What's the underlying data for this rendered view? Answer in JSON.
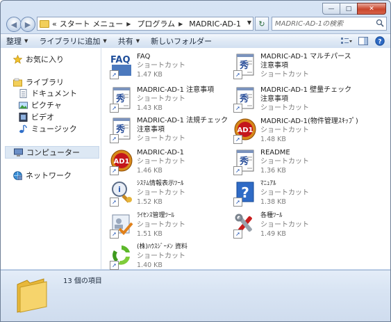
{
  "address": {
    "overflow": "«",
    "crumbs": [
      "スタート メニュー",
      "プログラム",
      "MADRIC-AD-1"
    ]
  },
  "search": {
    "placeholder": "MADRIC-AD-1の検索"
  },
  "toolbar": {
    "organize": "整理",
    "add_to_library": "ライブラリに追加",
    "share": "共有",
    "new_folder": "新しいフォルダー"
  },
  "nav": {
    "favorites": "お気に入り",
    "libraries": "ライブラリ",
    "documents": "ドキュメント",
    "pictures": "ピクチャ",
    "videos": "ビデオ",
    "music": "ミュージック",
    "computer": "コンピューター",
    "network": "ネットワーク"
  },
  "files": [
    {
      "name": "FAQ",
      "type": "ショートカット",
      "size": "1.47 KB",
      "icon": "faq-icon"
    },
    {
      "name": "MADRIC-AD-1 マルチパース 注意事項",
      "type": "ショートカット",
      "size": "",
      "icon": "document-icon"
    },
    {
      "name": "MADRIC-AD-1 注意事項",
      "type": "ショートカット",
      "size": "1.43 KB",
      "icon": "document-icon"
    },
    {
      "name": "MADRIC-AD-1 壁量チェック 注意事項",
      "type": "ショートカット",
      "size": "",
      "icon": "document-icon"
    },
    {
      "name": "MADRIC-AD-1 法規チェック 注意事項",
      "type": "ショートカット",
      "size": "",
      "icon": "document-icon"
    },
    {
      "name": "MADRIC-AD-1(物件管理ｽｷｯﾌﾟ)",
      "type": "ショートカット",
      "size": "1.48 KB",
      "icon": "ad1-app-icon"
    },
    {
      "name": "MADRIC-AD-1",
      "type": "ショートカット",
      "size": "1.46 KB",
      "icon": "ad1-app-icon"
    },
    {
      "name": "README",
      "type": "ショートカット",
      "size": "1.36 KB",
      "icon": "document-icon"
    },
    {
      "name": "ｼｽﾃﾑ情報表示ﾂｰﾙ",
      "type": "ショートカット",
      "size": "1.52 KB",
      "icon": "system-info-icon"
    },
    {
      "name": "ﾏﾆｭｱﾙ",
      "type": "ショートカット",
      "size": "1.38 KB",
      "icon": "help-icon"
    },
    {
      "name": "ﾗｲｾﾝｽ管理ﾂｰﾙ",
      "type": "ショートカット",
      "size": "1.51 KB",
      "icon": "license-icon"
    },
    {
      "name": "各種ﾂｰﾙ",
      "type": "ショートカット",
      "size": "1.49 KB",
      "icon": "tools-icon"
    },
    {
      "name": "(株)ﾊｳｽｼﾞｰﾒﾝ 資料",
      "type": "ショートカット",
      "size": "1.40 KB",
      "icon": "recycle-icon"
    }
  ],
  "details": {
    "count": "13 個の項目"
  }
}
